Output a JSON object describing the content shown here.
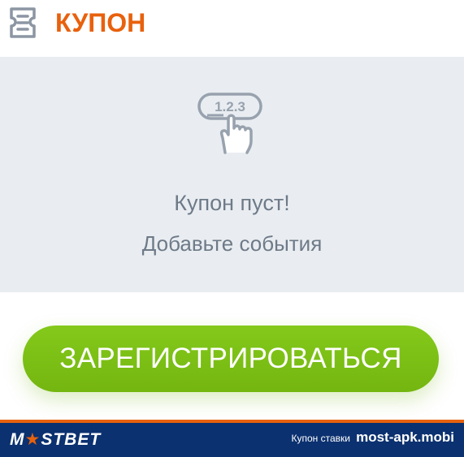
{
  "header": {
    "title": "КУПОН",
    "icon": "coupon-ticket-icon"
  },
  "empty_state": {
    "illustration_icon": "finger-tap-numbers-icon",
    "illustration_text": "1.2.3",
    "title": "Купон пуст!",
    "subtitle": "Добавьте события"
  },
  "cta": {
    "label": "ЗАРЕГИСТРИРОВАТЬСЯ"
  },
  "footer": {
    "logo_prefix": "M",
    "logo_star": "★",
    "logo_suffix": "STBET",
    "caption": "Купон ставки",
    "site": "most-apk.mobi"
  },
  "colors": {
    "accent": "#e8610d",
    "cta": "#7dbf15",
    "panel": "#e9edf1",
    "text_muted": "#6e7a88",
    "footer_bg": "#0b3170"
  }
}
